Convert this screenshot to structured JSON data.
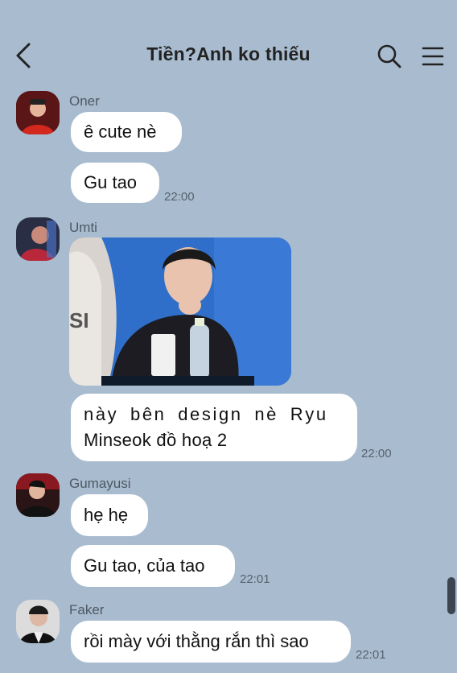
{
  "header": {
    "title": "Tiền?Anh ko thiếu"
  },
  "messages": [
    {
      "sender": "Oner",
      "bubbles": [
        "ê cute nè",
        "Gu tao"
      ],
      "time": "22:00"
    },
    {
      "sender": "Umti",
      "image": "photo",
      "text_line1": "này bên design nè Ryu",
      "text_line2": "Minseok đồ hoạ 2",
      "time": "22:00"
    },
    {
      "sender": "Gumayusi",
      "bubbles": [
        "hẹ hẹ",
        "Gu tao, của tao"
      ],
      "time": "22:01"
    },
    {
      "sender": "Faker",
      "bubbles": [
        "rồi mày với thằng rắn thì sao"
      ],
      "time": "22:01"
    }
  ],
  "photo_label": "SI",
  "icons": [
    "back-arrow-icon",
    "search-icon",
    "menu-icon"
  ],
  "colors": {
    "background": "#a9bccf",
    "bubble": "#ffffff",
    "photo_bg": "#2f6fc9"
  }
}
